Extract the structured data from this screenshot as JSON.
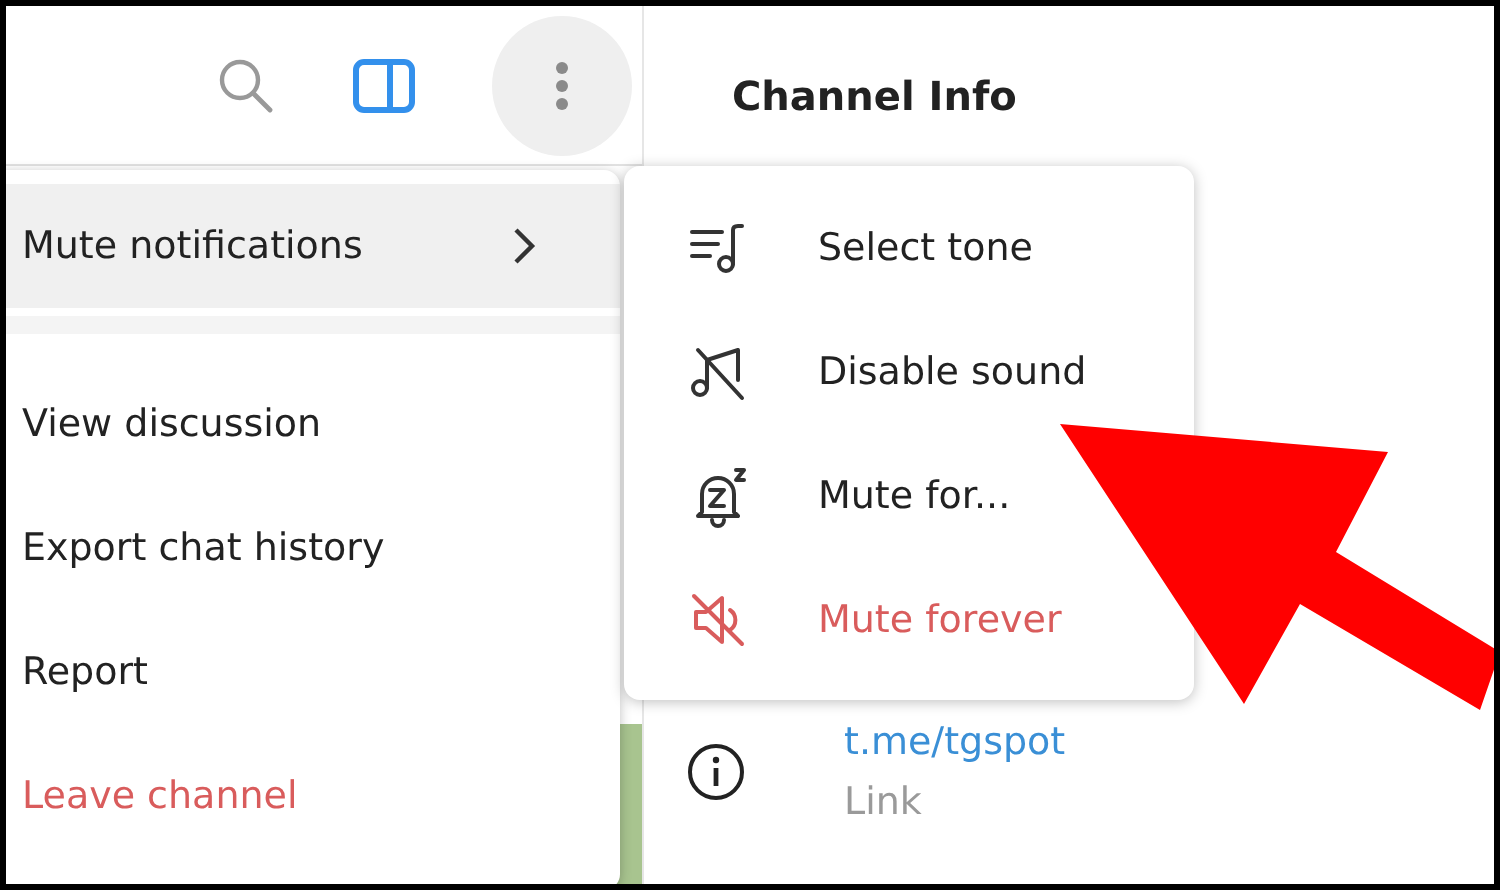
{
  "header": {
    "more_button": {
      "active": true
    }
  },
  "info_panel": {
    "title": "Channel Info",
    "link": {
      "value": "t.me/tgspot",
      "caption": "Link"
    }
  },
  "menu": {
    "items": [
      {
        "label": "Mute notifications",
        "kind": "submenu",
        "selected": true,
        "danger": false
      },
      {
        "kind": "separator"
      },
      {
        "label": "View discussion",
        "kind": "item",
        "selected": false,
        "danger": false
      },
      {
        "label": "Export chat history",
        "kind": "item",
        "selected": false,
        "danger": false
      },
      {
        "label": "Report",
        "kind": "item",
        "selected": false,
        "danger": false
      },
      {
        "label": "Leave channel",
        "kind": "item",
        "selected": false,
        "danger": true
      }
    ]
  },
  "submenu": {
    "items": [
      {
        "label": "Select tone",
        "kind": "tone",
        "danger": false
      },
      {
        "label": "Disable sound",
        "kind": "sound_off",
        "danger": false
      },
      {
        "label": "Mute for...",
        "kind": "mute_for",
        "danger": false
      },
      {
        "label": "Mute forever",
        "kind": "mute_forever",
        "danger": true
      }
    ]
  }
}
